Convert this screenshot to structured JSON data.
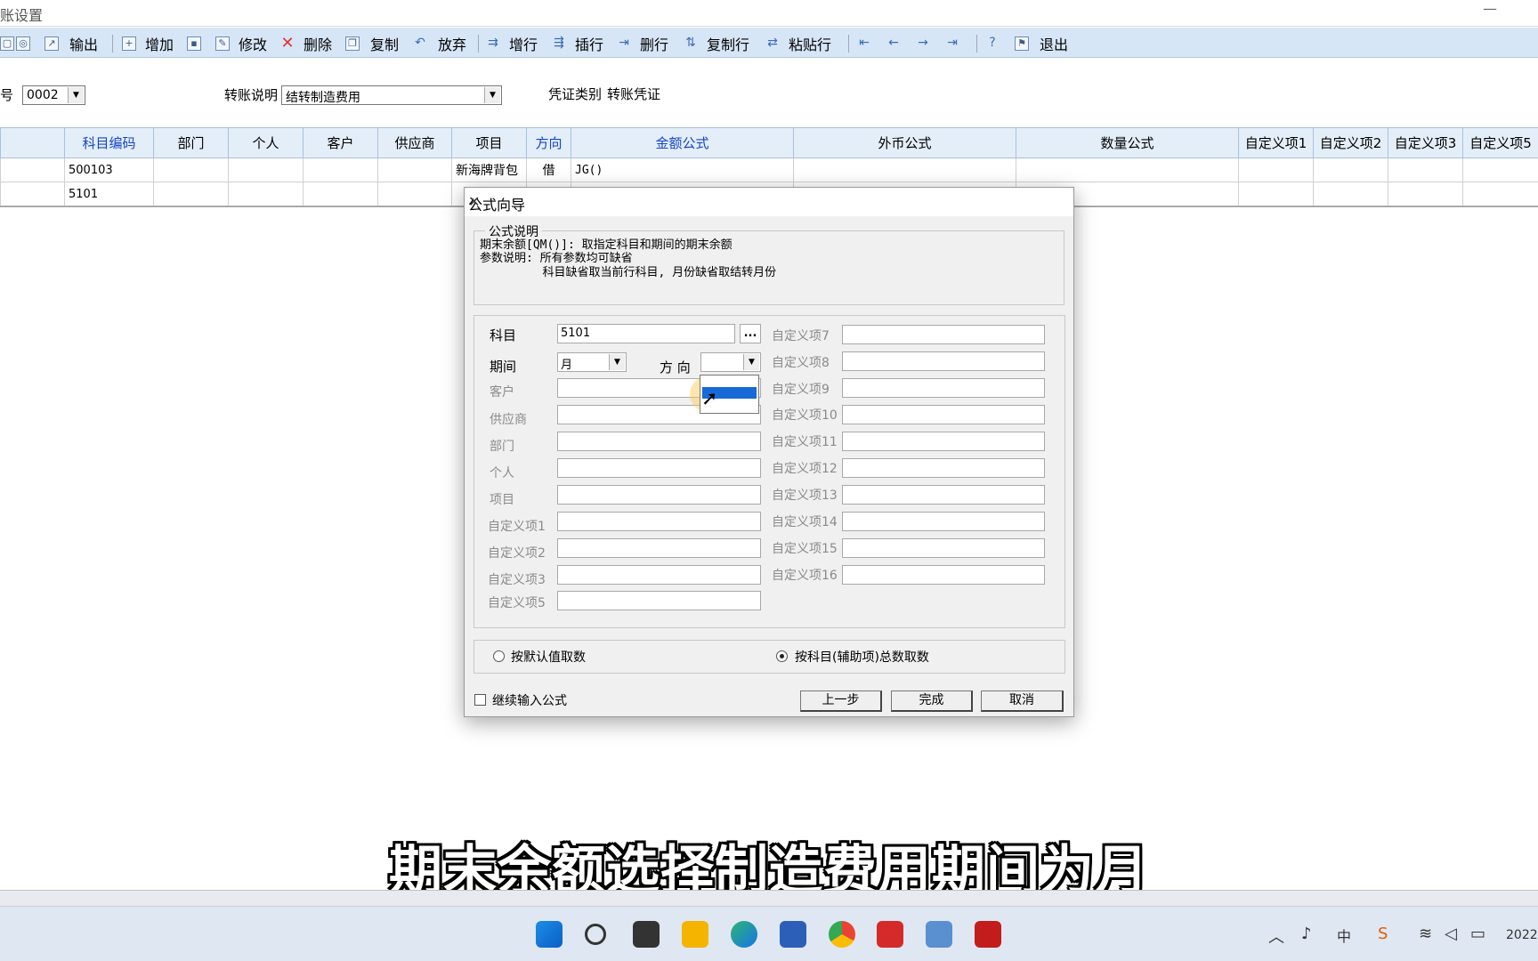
{
  "window": {
    "title": "账设置",
    "minimize": "—"
  },
  "toolbar": {
    "export": "输出",
    "add": "增加",
    "modify": "修改",
    "delete": "删除",
    "copy": "复制",
    "discard": "放弃",
    "add_row": "增行",
    "insert_row": "插行",
    "delete_row": "删行",
    "copy_row": "复制行",
    "paste_row": "粘贴行",
    "exit": "退出"
  },
  "header": {
    "voucher_no_label": "号",
    "voucher_no_value": "0002",
    "description_label": "转账说明",
    "description_value": "结转制造费用",
    "voucher_type_label": "凭证类别",
    "voucher_type_value": "转账凭证"
  },
  "grid": {
    "columns": [
      "",
      "科目编码",
      "部门",
      "个人",
      "客户",
      "供应商",
      "项目",
      "方向",
      "金额公式",
      "外币公式",
      "数量公式",
      "自定义项1",
      "自定义项2",
      "自定义项3",
      "自定义项5"
    ],
    "rows": [
      [
        "",
        "500103",
        "",
        "",
        "",
        "",
        "新海牌背包",
        "借",
        "JG()",
        "",
        "",
        "",
        "",
        "",
        ""
      ],
      [
        "",
        "5101",
        "",
        "",
        "",
        "",
        "",
        "",
        "",
        "",
        "",
        "",
        "",
        "",
        ""
      ]
    ]
  },
  "dialog": {
    "title": "公式向导",
    "close": "✕",
    "desc_group": "公式说明",
    "desc_line1": "期末余额[QM()]: 取指定科目和期间的期末余额",
    "desc_line2": "参数说明: 所有参数均可缺省",
    "desc_line3": "         科目缺省取当前行科目, 月份缺省取结转月份",
    "subject_label": "科目",
    "subject_value": "5101",
    "browse": "...",
    "period_label": "期间",
    "period_value": "月",
    "direction_label": "方 向",
    "direction_value": "",
    "customer_label": "客户",
    "supplier_label": "供应商",
    "dept_label": "部门",
    "person_label": "个人",
    "project_label": "项目",
    "c1": "自定义项1",
    "c2": "自定义项2",
    "c3": "自定义项3",
    "c5": "自定义项5",
    "c7": "自定义项7",
    "c8": "自定义项8",
    "c9": "自定义项9",
    "c10": "自定义项10",
    "c11": "自定义项11",
    "c12": "自定义项12",
    "c13": "自定义项13",
    "c14": "自定义项14",
    "c15": "自定义项15",
    "c16": "自定义项16",
    "radio_default": "按默认值取数",
    "radio_subject": "按科目(辅助项)总数取数",
    "continue_input": "继续输入公式",
    "prev": "上一步",
    "finish": "完成",
    "cancel": "取消"
  },
  "subtitle": "期末余额选择制造费用期间为月",
  "taskbar": {
    "clock": "2022",
    "ime": "中"
  }
}
